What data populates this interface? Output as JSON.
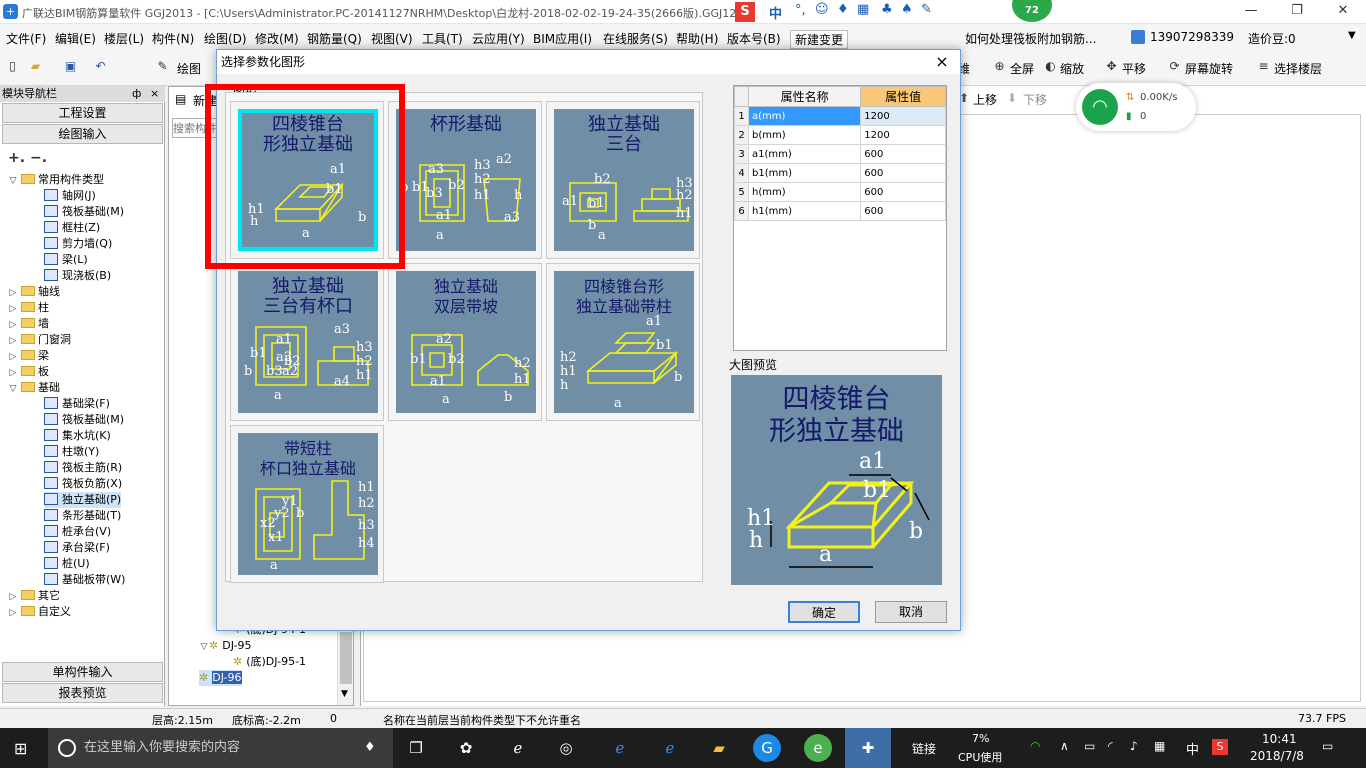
{
  "window": {
    "title": "广联达BIM钢筋算量软件 GGJ2013 - [C:\\Users\\Administrator.PC-20141127NRHM\\Desktop\\白龙村-2018-02-02-19-24-35(2666版).GGJ12]",
    "badge": "72"
  },
  "ime": {
    "label": "中"
  },
  "menu": [
    "文件(F)",
    "编辑(E)",
    "楼层(L)",
    "构件(N)",
    "绘图(D)",
    "修改(M)",
    "钢筋量(Q)",
    "视图(V)",
    "工具(T)",
    "云应用(Y)",
    "BIM应用(I)",
    "在线服务(S)",
    "帮助(H)",
    "版本号(B)",
    "新建变更"
  ],
  "notice": "如何处理筏板附加钢筋...",
  "account": {
    "phone": "13907298339",
    "beans": "造价豆:0"
  },
  "toolbar": {
    "draw": "绘图",
    "new": "新建",
    "right": [
      "全屏",
      "缩放",
      "平移",
      "屏幕旋转",
      "选择楼层"
    ],
    "right_partial": "维",
    "move_up": "上移",
    "move_down": "下移"
  },
  "left_panel": {
    "header": "模块导航栏",
    "pin": "ф",
    "close": "×",
    "btn_engineering": "工程设置",
    "btn_drawing": "绘图输入",
    "btn_single": "单构件输入",
    "btn_report": "报表预览"
  },
  "search": {
    "placeholder": "搜索构件"
  },
  "tree": [
    {
      "label": "常用构件类型",
      "level": 0,
      "toggle": "▽",
      "folder": true
    },
    {
      "label": "轴网(J)",
      "level": 2
    },
    {
      "label": "筏板基础(M)",
      "level": 2
    },
    {
      "label": "框柱(Z)",
      "level": 2
    },
    {
      "label": "剪力墙(Q)",
      "level": 2
    },
    {
      "label": "梁(L)",
      "level": 2
    },
    {
      "label": "现浇板(B)",
      "level": 2
    },
    {
      "label": "轴线",
      "level": 0,
      "toggle": "▷",
      "folder": true
    },
    {
      "label": "柱",
      "level": 0,
      "toggle": "▷",
      "folder": true
    },
    {
      "label": "墙",
      "level": 0,
      "toggle": "▷",
      "folder": true
    },
    {
      "label": "门窗洞",
      "level": 0,
      "toggle": "▷",
      "folder": true
    },
    {
      "label": "梁",
      "level": 0,
      "toggle": "▷",
      "folder": true
    },
    {
      "label": "板",
      "level": 0,
      "toggle": "▷",
      "folder": true
    },
    {
      "label": "基础",
      "level": 0,
      "toggle": "▽",
      "folder": true
    },
    {
      "label": "基础梁(F)",
      "level": 2
    },
    {
      "label": "筏板基础(M)",
      "level": 2
    },
    {
      "label": "集水坑(K)",
      "level": 2
    },
    {
      "label": "柱墩(Y)",
      "level": 2
    },
    {
      "label": "筏板主筋(R)",
      "level": 2
    },
    {
      "label": "筏板负筋(X)",
      "level": 2
    },
    {
      "label": "独立基础(P)",
      "level": 2,
      "selected": true
    },
    {
      "label": "条形基础(T)",
      "level": 2
    },
    {
      "label": "桩承台(V)",
      "level": 2
    },
    {
      "label": "承台梁(F)",
      "level": 2
    },
    {
      "label": "桩(U)",
      "level": 2
    },
    {
      "label": "基础板带(W)",
      "level": 2
    },
    {
      "label": "其它",
      "level": 0,
      "toggle": "▷",
      "folder": true
    },
    {
      "label": "自定义",
      "level": 0,
      "toggle": "▷",
      "folder": true
    }
  ],
  "mid_tree": [
    {
      "label": "(底)DJ-94-1",
      "level": 2
    },
    {
      "label": "DJ-95",
      "level": 1,
      "toggle": "▽"
    },
    {
      "label": "(底)DJ-95-1",
      "level": 2
    },
    {
      "label": "DJ-96",
      "level": 1,
      "selected": true
    }
  ],
  "status": {
    "floor_height": "层高:2.15m",
    "bottom_elev": "底标高:-2.2m",
    "zero": "0",
    "message": "名称在当前层当前构件类型下不允许重名",
    "fps": "73.7 FPS"
  },
  "dialog": {
    "title": "选择参数化图形",
    "close": "×",
    "group_label": "图形",
    "tiles": [
      {
        "id": "t1",
        "lines": [
          "四棱锥台",
          "形独立基础"
        ],
        "labels": [
          "a1",
          "b1",
          "h1",
          "h",
          "a",
          "b"
        ]
      },
      {
        "id": "t2",
        "lines": [
          "杯形基础"
        ],
        "labels": [
          "a2",
          "a3",
          "b3",
          "h3",
          "h2",
          "h1",
          "b",
          "b1",
          "b2",
          "a1",
          "a",
          "h",
          "a3"
        ]
      },
      {
        "id": "t3",
        "lines": [
          "独立基础",
          "三台"
        ],
        "labels": [
          "b2",
          "a1",
          "a",
          "b1",
          "h3",
          "h2",
          "h1",
          "b"
        ]
      },
      {
        "id": "t4",
        "lines": [
          "独立基础",
          "三台有杯口"
        ],
        "labels": [
          "a3",
          "a1",
          "b1",
          "a3",
          "b2",
          "b",
          "b3",
          "a2",
          "a",
          "h3",
          "h2",
          "h1",
          "a4"
        ]
      },
      {
        "id": "t5",
        "lines": [
          "独立基础",
          "双层带坡"
        ],
        "labels": [
          "a2",
          "b1",
          "b2",
          "a1",
          "a",
          "h2",
          "h1",
          "b"
        ]
      },
      {
        "id": "t6",
        "lines": [
          "四棱锥台形",
          "独立基础带柱"
        ],
        "labels": [
          "a1",
          "b1",
          "h2",
          "h1",
          "h",
          "a",
          "b"
        ]
      },
      {
        "id": "t7",
        "lines": [
          "带短柱",
          "杯口独立基础"
        ],
        "labels": [
          "y2",
          "y1",
          "x2",
          "x1",
          "a",
          "b",
          "h1",
          "h2",
          "h3",
          "h4"
        ]
      }
    ],
    "table": {
      "headers": [
        "属性名称",
        "属性值"
      ],
      "rows": [
        {
          "n": "1",
          "name": "a(mm)",
          "value": "1200"
        },
        {
          "n": "2",
          "name": "b(mm)",
          "value": "1200"
        },
        {
          "n": "3",
          "name": "a1(mm)",
          "value": "600"
        },
        {
          "n": "4",
          "name": "b1(mm)",
          "value": "600"
        },
        {
          "n": "5",
          "name": "h(mm)",
          "value": "600"
        },
        {
          "n": "6",
          "name": "h1(mm)",
          "value": "600"
        }
      ]
    },
    "preview_label": "大图预览",
    "preview_lines": [
      "四棱锥台",
      "形独立基础"
    ],
    "preview_labels": [
      "a1",
      "b1",
      "h1",
      "h",
      "a",
      "b"
    ],
    "ok": "确定",
    "cancel": "取消"
  },
  "network": {
    "speed": "0.00K/s",
    "count": "0"
  },
  "taskbar": {
    "search": "在这里输入你要搜索的内容",
    "link": "链接",
    "cpu_pct": "7%",
    "cpu_label": "CPU使用",
    "lang": "中",
    "time": "10:41",
    "date": "2018/7/8"
  },
  "colors": {
    "accent": "#0078d7",
    "tile_bg": "#708fa6",
    "tile_text": "#15196a",
    "figure": "#f2f21a",
    "selected_outline": "#00e5f5",
    "highlight": "#ff0000",
    "header_value": "#f8c878"
  }
}
